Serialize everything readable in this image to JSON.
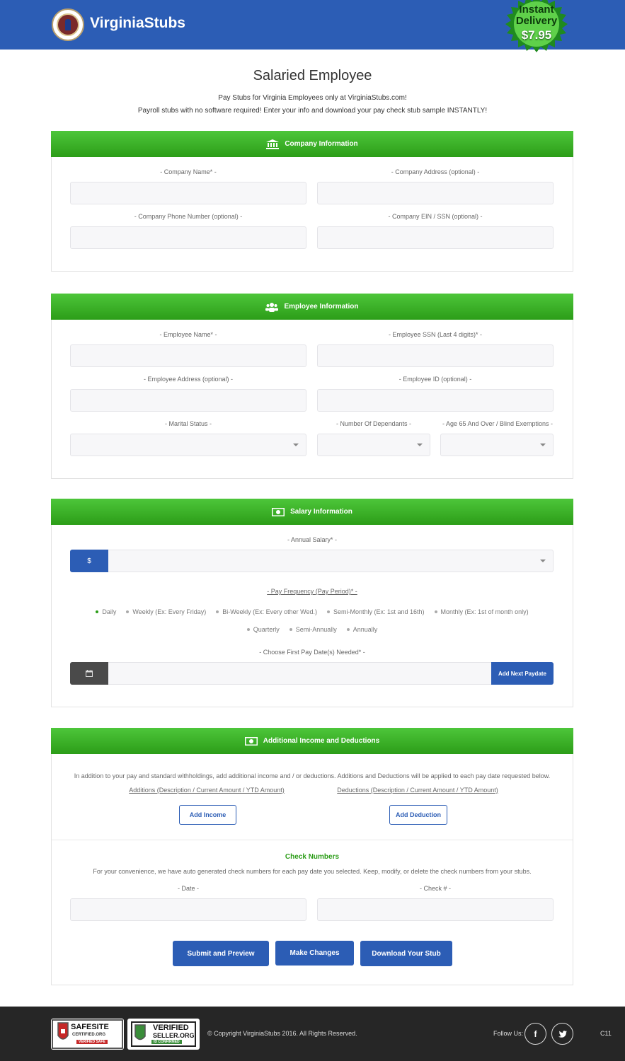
{
  "header": {
    "brand": "VirginiaStubs",
    "badge_line1": "Instant",
    "badge_line2": "Delivery",
    "badge_price": "$7.95"
  },
  "page": {
    "title": "Salaried Employee",
    "intro1": "Pay Stubs for Virginia Employees only at VirginiaStubs.com!",
    "intro2": "Payroll stubs with no software required! Enter your info and download your pay check stub sample INSTANTLY!"
  },
  "company": {
    "heading": "Company Information",
    "name_label": "- Company Name* -",
    "address_label": "- Company Address (optional) -",
    "phone_label": "- Company Phone Number (optional) -",
    "ein_label": "- Company EIN / SSN (optional) -"
  },
  "employee": {
    "heading": "Employee Information",
    "name_label": "- Employee Name* -",
    "ssn_label": "- Employee SSN (Last 4 digits)* -",
    "address_label": "- Employee Address (optional) -",
    "id_label": "- Employee ID (optional) -",
    "marital_label": "- Marital Status -",
    "dependants_label": "- Number Of Dependants -",
    "exemptions_label": "- Age 65 And Over / Blind Exemptions -"
  },
  "salary": {
    "heading": "Salary Information",
    "annual_label": "- Annual Salary* -",
    "currency_symbol": "$",
    "frequency_label": "- Pay Frequency (Pay Period)* -",
    "frequencies_row1": [
      "Daily",
      "Weekly (Ex: Every Friday)",
      "Bi-Weekly (Ex: Every other Wed.)",
      "Semi-Monthly (Ex: 1st and 16th)",
      "Monthly (Ex: 1st of month only)"
    ],
    "frequencies_row2": [
      "Quarterly",
      "Semi-Annually",
      "Annually"
    ],
    "selected_frequency": "Daily",
    "paydate_label": "- Choose First Pay Date(s) Needed* -",
    "add_paydate": "Add Next Paydate"
  },
  "additional": {
    "heading": "Additional Income and Deductions",
    "description": "In addition to your pay and standard withholdings, add additional income and / or deductions. Additions and Deductions will be applied to each pay date requested below.",
    "additions_label": "Additions (Description / Current Amount / YTD Amount)",
    "deductions_label": "Deductions (Description / Current Amount / YTD Amount)",
    "add_income": "Add Income",
    "add_deduction": "Add Deduction"
  },
  "checks": {
    "heading": "Check Numbers",
    "description": "For your convenience, we have auto generated check numbers for each pay date you selected. Keep, modify, or delete the check numbers from your stubs.",
    "date_label": "- Date -",
    "check_label": "- Check # -"
  },
  "actions": {
    "submit": "Submit and Preview",
    "changes": "Make Changes",
    "download": "Download Your Stub"
  },
  "footer": {
    "safesite_title": "SAFESITE",
    "safesite_sub": "CERTIFIED.ORG",
    "safesite_tag": "VERIFIED SAFE",
    "verified_title": "VERIFIED",
    "verified_sub": "SELLER.ORG",
    "verified_tag": "ID CONFIRMED",
    "copyright": "© Copyright VirginiaStubs 2016. All Rights Reserved.",
    "follow": "Follow Us:",
    "facebook": "f",
    "code": "C11"
  },
  "colors": {
    "header_blue": "#2c5db5",
    "section_green": "#2c9d18",
    "footer_dark": "#262626"
  }
}
